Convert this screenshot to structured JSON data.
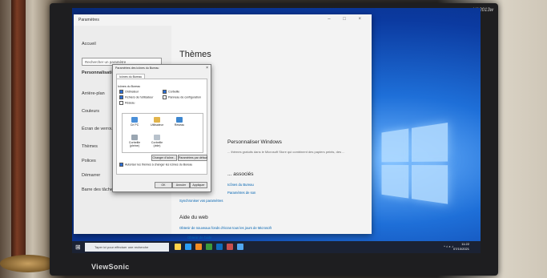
{
  "bezel": {
    "brand": "ViewSonic",
    "model": "VA2013w"
  },
  "settings": {
    "caption": "Paramètres",
    "controls": "– □ ×",
    "nav": [
      "Accueil",
      "Personnalisation",
      "Arrière-plan",
      "Couleurs",
      "Écran de verrouillage",
      "Thèmes",
      "Polices",
      "Démarrer",
      "Barre des tâches"
    ],
    "search_placeholder": "Rechercher un paramètre",
    "title": "Thèmes",
    "section_windows": "Personnaliser Windows",
    "section_windows_text": "... thèmes gratuits dans le Microsoft Store qui combinent des papiers peints, des ...",
    "section_related": "... associés",
    "related_links": [
      "Icônes du Bureau",
      "Paramètres de son",
      "Synchroniser vos paramètres"
    ],
    "section_help": "Aide du web",
    "help_link": "Obtenir de nouveaux fonds d'écran tous les jours de Microsoft",
    "help_bottom": [
      "Obtenir de l'aide",
      "Envoyer des commentaires"
    ]
  },
  "dialog": {
    "title": "Paramètres des icônes du Bureau",
    "tab": "Icônes du Bureau",
    "group": "Icônes du Bureau",
    "checkboxes": [
      {
        "label": "Ordinateur",
        "checked": true
      },
      {
        "label": "Corbeille",
        "checked": true
      },
      {
        "label": "Fichiers de l'utilisateur",
        "checked": true
      },
      {
        "label": "Panneau de configuration",
        "checked": false
      },
      {
        "label": "Réseau",
        "checked": false
      }
    ],
    "icons": [
      "Ce PC",
      "Utilisateur",
      "Réseau",
      "Corbeille (pleine)",
      "Corbeille (vide)"
    ],
    "change_icon": "Changer d'icône...",
    "restore": "Paramètres par défaut",
    "allow_themes": "Autoriser les thèmes à changer les icônes du Bureau",
    "ok": "OK",
    "cancel": "Annuler",
    "apply": "Appliquer"
  },
  "taskbar": {
    "search_placeholder": "Taper ici pour effectuer une recherche",
    "time": "11:22",
    "date": "07/10/2021",
    "app_colors": [
      "#ffd24a",
      "#2a9df4",
      "#f28b22",
      "#3c9b3c",
      "#0f6cbd",
      "#c94f4f",
      "#52a7f0"
    ]
  },
  "colors": {
    "accent": "#0063b1",
    "wallpaper": "#1e6fd8"
  }
}
